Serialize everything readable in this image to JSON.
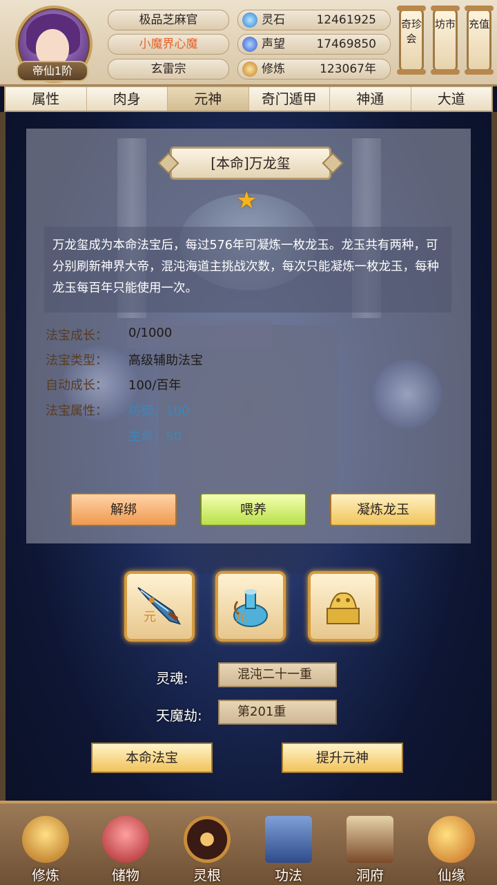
{
  "header": {
    "rank_badge": "帝仙1阶",
    "titles": [
      "极品芝麻官",
      "小魔界心魔",
      "玄雷宗"
    ],
    "resources": [
      {
        "icon": "spirit-stone-icon",
        "label": "灵石",
        "value": "12461925"
      },
      {
        "icon": "prestige-icon",
        "label": "声望",
        "value": "17469850"
      },
      {
        "icon": "cultivation-icon",
        "label": "修炼",
        "value": "123067年"
      }
    ],
    "side_buttons": [
      "奇珍会",
      "坊市",
      "充值"
    ]
  },
  "tabs": [
    "属性",
    "肉身",
    "元神",
    "奇门遁甲",
    "神通",
    "大道"
  ],
  "active_tab": "元神",
  "panel": {
    "title": "[本命]万龙玺",
    "description": "万龙玺成为本命法宝后，每过576年可凝炼一枚龙玉。龙玉共有两种，可分别刷新神界大帝，混沌海道主挑战次数，每次只能凝炼一枚龙玉，每种龙玉每百年只能使用一次。",
    "growth_label": "法宝成长：",
    "growth_value": "0/1000",
    "type_label": "法宝类型：",
    "type_value": "高级辅助法宝",
    "auto_label": "自动成长：",
    "auto_value": "100/百年",
    "attr_label": "法宝属性：",
    "attr_defense": "防御：100",
    "attr_life": "生命：50",
    "buttons": {
      "unbind": "解绑",
      "feed": "喂养",
      "refine": "凝炼龙玉"
    }
  },
  "treasures": [
    "saber-icon",
    "gourd-vase-icon",
    "dragon-seal-icon"
  ],
  "treasure_marks": [
    "元",
    "元"
  ],
  "soul": {
    "label": "灵魂:",
    "value": "混沌二十一重"
  },
  "tribulation": {
    "label": "天魔劫:",
    "value": "第201重"
  },
  "actions": {
    "natal_treasure": "本命法宝",
    "upgrade": "提升元神"
  },
  "bottom_nav": [
    "修炼",
    "储物",
    "灵根",
    "功法",
    "洞府",
    "仙缘"
  ]
}
